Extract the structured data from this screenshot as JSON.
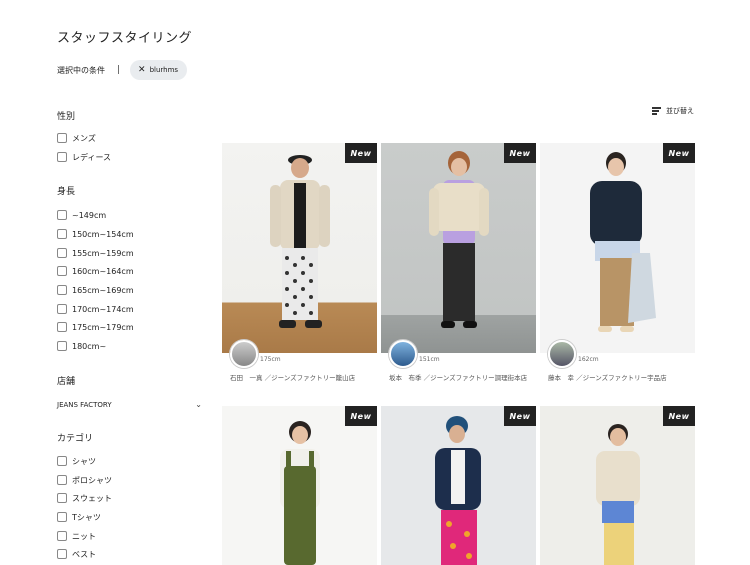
{
  "page": {
    "title": "スタッフスタイリング"
  },
  "conditions": {
    "label": "選択中の条件",
    "separator": "|",
    "chip_label": "blurhms"
  },
  "sort": {
    "label": "並び替え"
  },
  "filters": {
    "gender": {
      "title": "性別",
      "options": [
        "メンズ",
        "レディース"
      ]
    },
    "height": {
      "title": "身長",
      "options": [
        "~149cm",
        "150cm~154cm",
        "155cm~159cm",
        "160cm~164cm",
        "165cm~169cm",
        "170cm~174cm",
        "175cm~179cm",
        "180cm~"
      ]
    },
    "store": {
      "title": "店舗",
      "selected": "JEANS FACTORY"
    },
    "category": {
      "title": "カテゴリ",
      "options": [
        "シャツ",
        "ポロシャツ",
        "スウェット",
        "Tシャツ",
        "ニット",
        "ベスト"
      ]
    }
  },
  "cards": [
    {
      "badge": "New",
      "height": "175cm",
      "staff": "石田　一真 ／ジーンズファクトリー籠山店"
    },
    {
      "badge": "New",
      "height": "151cm",
      "staff": "坂本　布季 ／ジーンズファクトリー調理街本店"
    },
    {
      "badge": "New",
      "height": "162cm",
      "staff": "藤本　幸 ／ジーンズファクトリー宇品店"
    },
    {
      "badge": "New"
    },
    {
      "badge": "New"
    },
    {
      "badge": "New"
    }
  ],
  "colors": {
    "chip_bg": "#e9ecef",
    "badge_bg": "#222222",
    "text": "#222222"
  },
  "icons": {
    "chip_remove": "close-icon",
    "sort": "sort-icon",
    "store_select": "chevron-down-icon"
  }
}
